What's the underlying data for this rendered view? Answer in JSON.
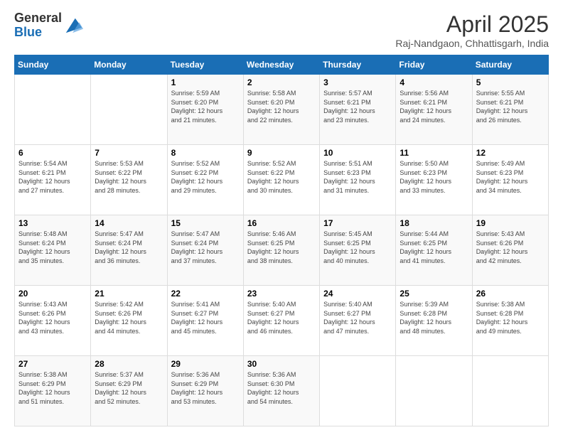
{
  "header": {
    "logo_general": "General",
    "logo_blue": "Blue",
    "title": "April 2025",
    "location": "Raj-Nandgaon, Chhattisgarh, India"
  },
  "days_of_week": [
    "Sunday",
    "Monday",
    "Tuesday",
    "Wednesday",
    "Thursday",
    "Friday",
    "Saturday"
  ],
  "weeks": [
    [
      {
        "day": null
      },
      {
        "day": null
      },
      {
        "day": "1",
        "sunrise": "5:59 AM",
        "sunset": "6:20 PM",
        "daylight": "12 hours and 21 minutes."
      },
      {
        "day": "2",
        "sunrise": "5:58 AM",
        "sunset": "6:20 PM",
        "daylight": "12 hours and 22 minutes."
      },
      {
        "day": "3",
        "sunrise": "5:57 AM",
        "sunset": "6:21 PM",
        "daylight": "12 hours and 23 minutes."
      },
      {
        "day": "4",
        "sunrise": "5:56 AM",
        "sunset": "6:21 PM",
        "daylight": "12 hours and 24 minutes."
      },
      {
        "day": "5",
        "sunrise": "5:55 AM",
        "sunset": "6:21 PM",
        "daylight": "12 hours and 26 minutes."
      }
    ],
    [
      {
        "day": "6",
        "sunrise": "5:54 AM",
        "sunset": "6:21 PM",
        "daylight": "12 hours and 27 minutes."
      },
      {
        "day": "7",
        "sunrise": "5:53 AM",
        "sunset": "6:22 PM",
        "daylight": "12 hours and 28 minutes."
      },
      {
        "day": "8",
        "sunrise": "5:52 AM",
        "sunset": "6:22 PM",
        "daylight": "12 hours and 29 minutes."
      },
      {
        "day": "9",
        "sunrise": "5:52 AM",
        "sunset": "6:22 PM",
        "daylight": "12 hours and 30 minutes."
      },
      {
        "day": "10",
        "sunrise": "5:51 AM",
        "sunset": "6:23 PM",
        "daylight": "12 hours and 31 minutes."
      },
      {
        "day": "11",
        "sunrise": "5:50 AM",
        "sunset": "6:23 PM",
        "daylight": "12 hours and 33 minutes."
      },
      {
        "day": "12",
        "sunrise": "5:49 AM",
        "sunset": "6:23 PM",
        "daylight": "12 hours and 34 minutes."
      }
    ],
    [
      {
        "day": "13",
        "sunrise": "5:48 AM",
        "sunset": "6:24 PM",
        "daylight": "12 hours and 35 minutes."
      },
      {
        "day": "14",
        "sunrise": "5:47 AM",
        "sunset": "6:24 PM",
        "daylight": "12 hours and 36 minutes."
      },
      {
        "day": "15",
        "sunrise": "5:47 AM",
        "sunset": "6:24 PM",
        "daylight": "12 hours and 37 minutes."
      },
      {
        "day": "16",
        "sunrise": "5:46 AM",
        "sunset": "6:25 PM",
        "daylight": "12 hours and 38 minutes."
      },
      {
        "day": "17",
        "sunrise": "5:45 AM",
        "sunset": "6:25 PM",
        "daylight": "12 hours and 40 minutes."
      },
      {
        "day": "18",
        "sunrise": "5:44 AM",
        "sunset": "6:25 PM",
        "daylight": "12 hours and 41 minutes."
      },
      {
        "day": "19",
        "sunrise": "5:43 AM",
        "sunset": "6:26 PM",
        "daylight": "12 hours and 42 minutes."
      }
    ],
    [
      {
        "day": "20",
        "sunrise": "5:43 AM",
        "sunset": "6:26 PM",
        "daylight": "12 hours and 43 minutes."
      },
      {
        "day": "21",
        "sunrise": "5:42 AM",
        "sunset": "6:26 PM",
        "daylight": "12 hours and 44 minutes."
      },
      {
        "day": "22",
        "sunrise": "5:41 AM",
        "sunset": "6:27 PM",
        "daylight": "12 hours and 45 minutes."
      },
      {
        "day": "23",
        "sunrise": "5:40 AM",
        "sunset": "6:27 PM",
        "daylight": "12 hours and 46 minutes."
      },
      {
        "day": "24",
        "sunrise": "5:40 AM",
        "sunset": "6:27 PM",
        "daylight": "12 hours and 47 minutes."
      },
      {
        "day": "25",
        "sunrise": "5:39 AM",
        "sunset": "6:28 PM",
        "daylight": "12 hours and 48 minutes."
      },
      {
        "day": "26",
        "sunrise": "5:38 AM",
        "sunset": "6:28 PM",
        "daylight": "12 hours and 49 minutes."
      }
    ],
    [
      {
        "day": "27",
        "sunrise": "5:38 AM",
        "sunset": "6:29 PM",
        "daylight": "12 hours and 51 minutes."
      },
      {
        "day": "28",
        "sunrise": "5:37 AM",
        "sunset": "6:29 PM",
        "daylight": "12 hours and 52 minutes."
      },
      {
        "day": "29",
        "sunrise": "5:36 AM",
        "sunset": "6:29 PM",
        "daylight": "12 hours and 53 minutes."
      },
      {
        "day": "30",
        "sunrise": "5:36 AM",
        "sunset": "6:30 PM",
        "daylight": "12 hours and 54 minutes."
      },
      {
        "day": null
      },
      {
        "day": null
      },
      {
        "day": null
      }
    ]
  ],
  "labels": {
    "sunrise_prefix": "Sunrise: ",
    "sunset_prefix": "Sunset: ",
    "daylight_prefix": "Daylight: "
  }
}
